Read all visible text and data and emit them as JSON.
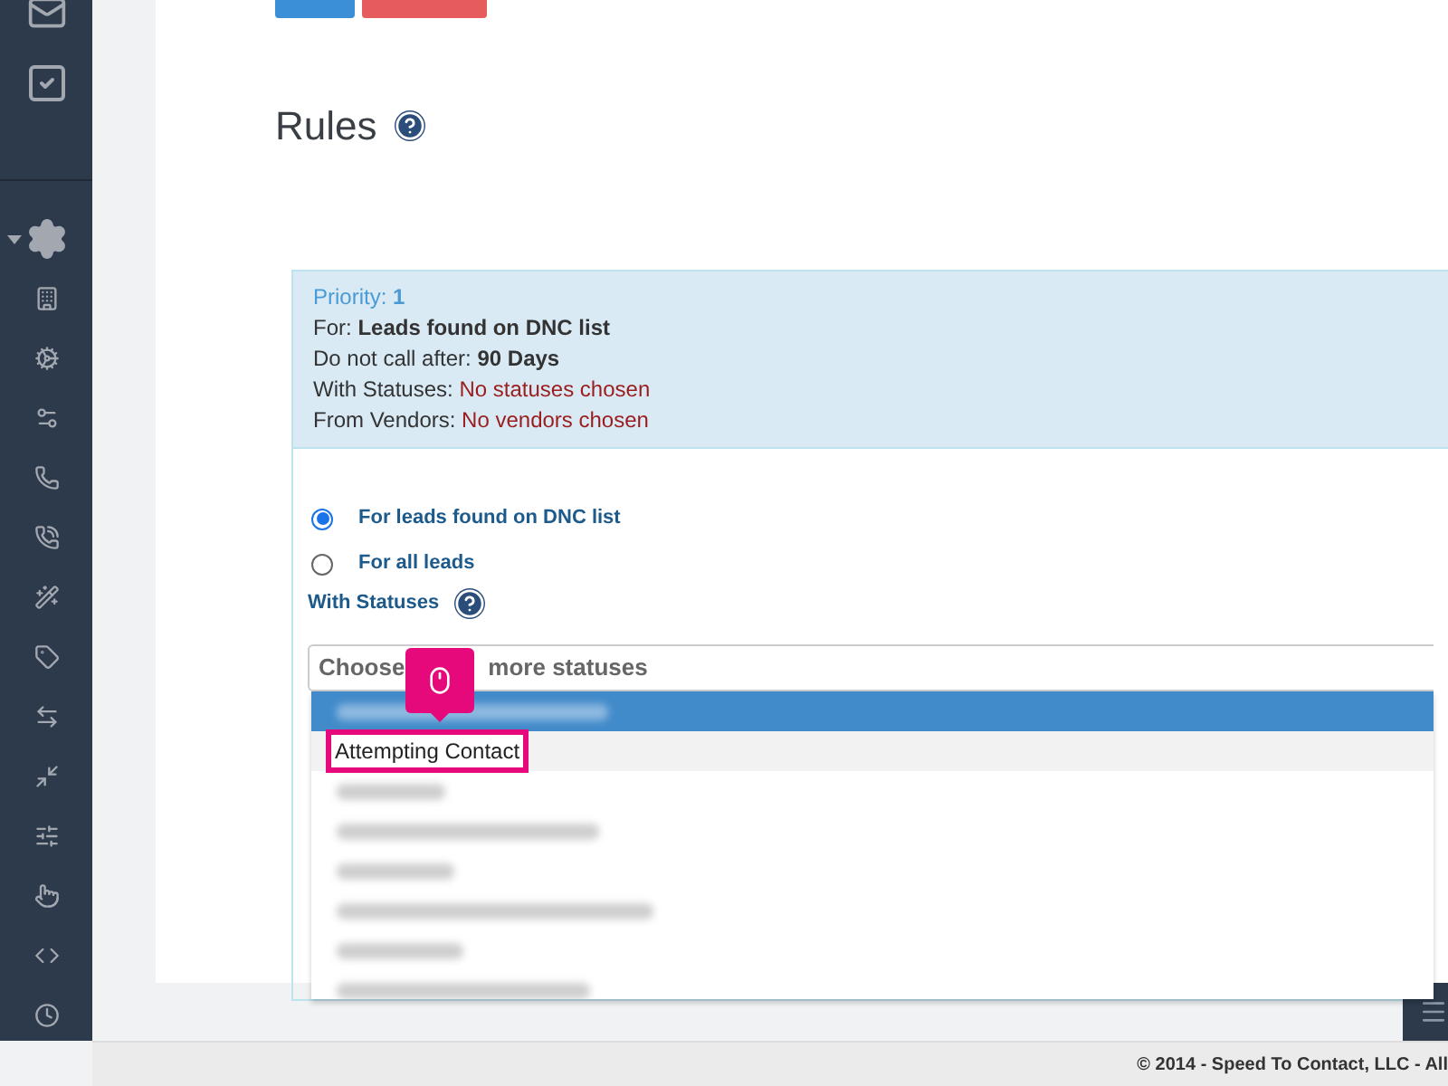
{
  "heading": {
    "title": "Rules"
  },
  "rule_summary": {
    "priority_label": "Priority:",
    "priority": "1",
    "lines": [
      {
        "label": "For:",
        "value": "Leads found on DNC list",
        "kind": "bold"
      },
      {
        "label": "Do not call after:",
        "value": "90 Days",
        "kind": "bold"
      },
      {
        "label": "With Statuses:",
        "value": "No statuses chosen",
        "kind": "warning"
      },
      {
        "label": "From Vendors:",
        "value": "No vendors chosen",
        "kind": "warning"
      }
    ]
  },
  "lead_options": [
    {
      "label": "For leads found on DNC list",
      "selected": true
    },
    {
      "label": "For all leads",
      "selected": false
    }
  ],
  "statuses": {
    "label": "With Statuses",
    "placeholder_start": "Choose",
    "placeholder_end": "more statuses",
    "options": [
      {
        "kind": "redacted",
        "highlighted": true
      },
      {
        "kind": "text",
        "label": "Attempting Contact",
        "highlighted": false,
        "callout": true
      },
      {
        "kind": "redacted",
        "highlighted": false
      },
      {
        "kind": "redacted",
        "highlighted": false
      },
      {
        "kind": "redacted",
        "highlighted": false
      },
      {
        "kind": "redacted",
        "highlighted": false
      },
      {
        "kind": "redacted",
        "highlighted": false
      },
      {
        "kind": "redacted",
        "highlighted": false
      }
    ]
  },
  "footer": {
    "copyright": "© 2014 - Speed To Contact, LLC - All"
  }
}
